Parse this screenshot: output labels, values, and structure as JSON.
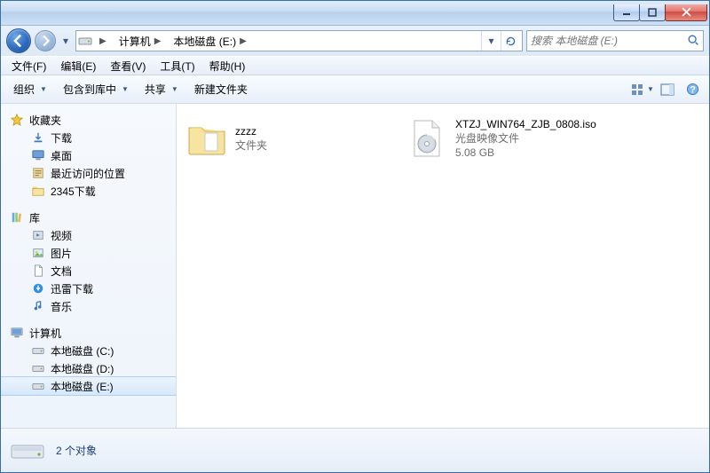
{
  "titlebar": {
    "minimize": "–",
    "maximize": "□",
    "close": "×"
  },
  "address": {
    "crumbs": [
      "计算机",
      "本地磁盘 (E:)"
    ],
    "sep": "▶"
  },
  "search": {
    "placeholder": "搜索 本地磁盘 (E:)"
  },
  "menubar": [
    "文件(F)",
    "编辑(E)",
    "查看(V)",
    "工具(T)",
    "帮助(H)"
  ],
  "toolbar": {
    "organize": "组织",
    "include": "包含到库中",
    "share": "共享",
    "newfolder": "新建文件夹"
  },
  "sidebar": {
    "favorites": {
      "label": "收藏夹",
      "items": [
        "下载",
        "桌面",
        "最近访问的位置",
        "2345下载"
      ]
    },
    "libraries": {
      "label": "库",
      "items": [
        "视频",
        "图片",
        "文档",
        "迅雷下载",
        "音乐"
      ]
    },
    "computer": {
      "label": "计算机",
      "items": [
        "本地磁盘 (C:)",
        "本地磁盘 (D:)",
        "本地磁盘 (E:)"
      ],
      "selected": 2
    }
  },
  "content": {
    "items": [
      {
        "name": "zzzz",
        "type": "文件夹",
        "kind": "folder"
      },
      {
        "name": "XTZJ_WIN764_ZJB_0808.iso",
        "type": "光盘映像文件",
        "size": "5.08 GB",
        "kind": "iso"
      }
    ]
  },
  "details": {
    "summary": "2 个对象"
  }
}
